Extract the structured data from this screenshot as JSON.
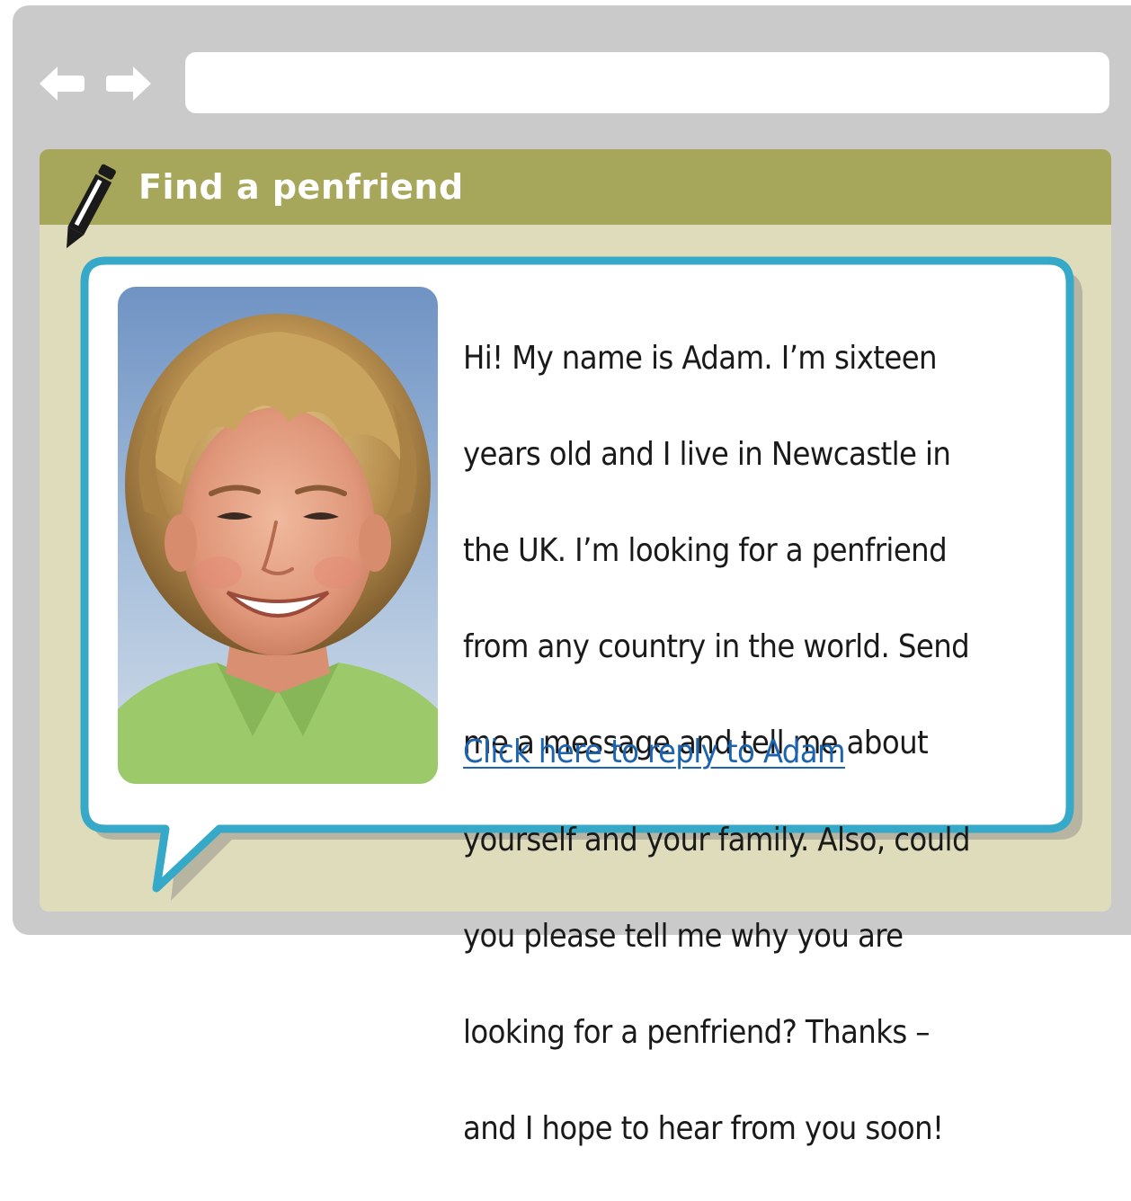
{
  "browser": {
    "address_value": "",
    "nav": {
      "back_icon": "back-arrow-icon",
      "forward_icon": "forward-arrow-icon"
    }
  },
  "page": {
    "title": "Find a penfriend",
    "title_icon": "pencil-icon",
    "message": {
      "lines": [
        "Hi! My name is Adam. I’m sixteen",
        "years old and I live in Newcastle in",
        "the UK. I’m looking for a penfriend",
        "from any country in the world. Send",
        "me a message and tell me about",
        "yourself and your family. Also, could",
        "you please tell me why you are",
        "looking for a penfriend? Thanks –",
        "and I hope to hear from you soon!"
      ],
      "reply_link": "Click here to reply to Adam"
    }
  },
  "colors": {
    "frame": "#cacaca",
    "panel": "#dfdcbc",
    "header": "#a6a75a",
    "bubble_border": "#36a9c9",
    "link": "#1d64b0"
  }
}
